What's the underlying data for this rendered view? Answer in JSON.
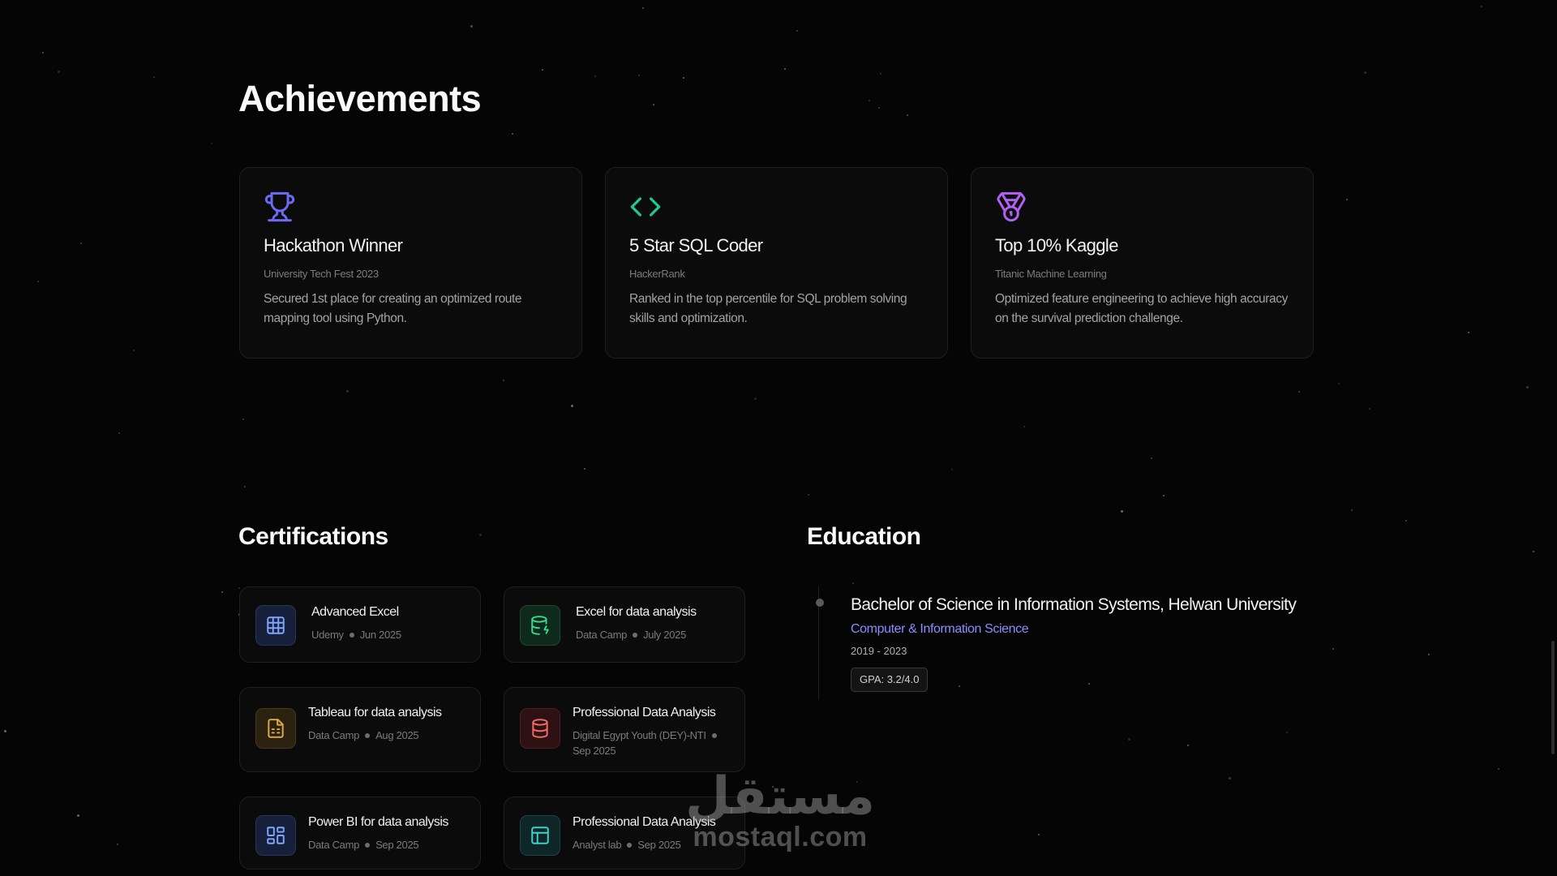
{
  "achievements": {
    "title": "Achievements",
    "items": [
      {
        "title": "Hackathon Winner",
        "org": "University Tech Fest 2023",
        "desc": "Secured 1st place for creating an optimized route mapping tool using Python.",
        "icon": "trophy-icon",
        "color": "#6b6bf5"
      },
      {
        "title": "5 Star SQL Coder",
        "org": "HackerRank",
        "desc": "Ranked in the top percentile for SQL problem solving skills and optimization.",
        "icon": "code-icon",
        "color": "#22c58b"
      },
      {
        "title": "Top 10% Kaggle",
        "org": "Titanic Machine Learning",
        "desc": "Optimized feature engineering to achieve high accuracy on the survival prediction challenge.",
        "icon": "medal-icon",
        "color": "#b160f0"
      }
    ]
  },
  "certifications": {
    "title": "Certifications",
    "items": [
      {
        "name": "Advanced Excel",
        "issuer": "Udemy",
        "date": "Jun 2025",
        "icon": "table-icon",
        "color": "#7ea4ff",
        "bg": "#16203a"
      },
      {
        "name": "Excel for data analysis",
        "issuer": "Data Camp",
        "date": "July 2025",
        "icon": "database-bolt-icon",
        "color": "#36d98a",
        "bg": "#0f2a1c"
      },
      {
        "name": "Tableau for data analysis",
        "issuer": "Data Camp",
        "date": "Aug 2025",
        "icon": "file-spreadsheet-icon",
        "color": "#e0a94a",
        "bg": "#2c2210"
      },
      {
        "name": "Professional Data Analysis",
        "issuer": "Digital Egypt Youth (DEY)-NTI",
        "date": "Sep 2025",
        "icon": "database-icon",
        "color": "#f16a6a",
        "bg": "#2e1213"
      },
      {
        "name": "Power BI for data analysis",
        "issuer": "Data Camp",
        "date": "Sep 2025",
        "icon": "dashboard-icon",
        "color": "#7ea4ff",
        "bg": "#16203a"
      },
      {
        "name": "Professional Data Analysis",
        "issuer": "Analyst lab",
        "date": "Sep 2025",
        "icon": "layout-icon",
        "color": "#3fd0c9",
        "bg": "#0e2627"
      }
    ]
  },
  "education": {
    "title": "Education",
    "degree": "Bachelor of Science in Information Systems, Helwan University",
    "field": "Computer & Information Science",
    "years": "2019 - 2023",
    "gpa": "GPA: 3.2/4.0"
  },
  "watermark": {
    "arabic": "مستقل",
    "latin": "mostaql.com"
  }
}
